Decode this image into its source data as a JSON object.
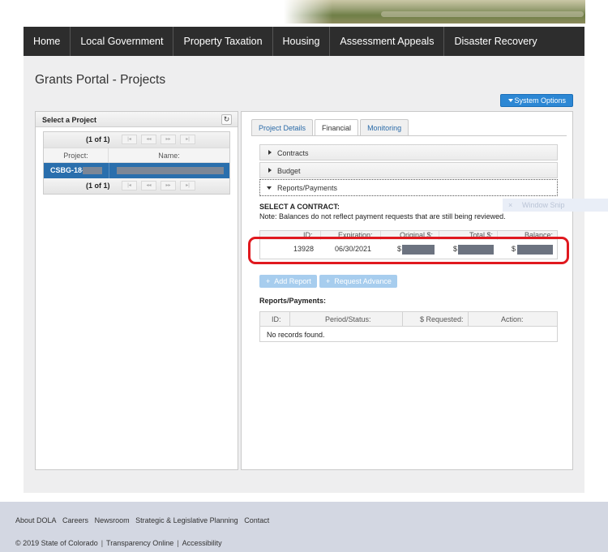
{
  "nav": {
    "items": [
      "Home",
      "Local Government",
      "Property Taxation",
      "Housing",
      "Assessment Appeals",
      "Disaster Recovery"
    ]
  },
  "page": {
    "title": "Grants Portal - Projects"
  },
  "system_options": {
    "label": "System Options"
  },
  "left_panel": {
    "title": "Select a Project",
    "pager_report": "(1 of 1)",
    "pager_buttons": [
      "|◂",
      "◂◂",
      "▸▸",
      "▸|"
    ],
    "columns": [
      "Project:",
      "Name:"
    ],
    "selected_project_prefix": "CSBG-18-"
  },
  "right_panel": {
    "tabs": [
      "Project Details",
      "Financial",
      "Monitoring"
    ],
    "active_tab": "Financial",
    "accordion": [
      "Contracts",
      "Budget",
      "Reports/Payments"
    ],
    "select_contract_label": "SELECT A CONTRACT:",
    "select_contract_note": "Note: Balances do not reflect payment requests that are still being reviewed.",
    "contract_columns": [
      "ID:",
      "Expiration:",
      "Original $:",
      "Total $:",
      "Balance:"
    ],
    "contract_row": {
      "id": "13928",
      "expiration": "06/30/2021",
      "original": "$",
      "total": "$",
      "balance": "$"
    },
    "add_report_label": "Add Report",
    "request_advance_label": "Request Advance",
    "reports_label": "Reports/Payments:",
    "reports_columns": [
      "ID:",
      "Period/Status:",
      "$ Requested:",
      "Action:"
    ],
    "reports_empty": "No records found."
  },
  "window_snip": {
    "label": "Window Snip"
  },
  "footer": {
    "links": [
      "About DOLA",
      "Careers",
      "Newsroom",
      "Strategic & Legislative Planning",
      "Contact"
    ],
    "copyright": "© 2019 State of Colorado",
    "bottom_links": [
      "Transparency Online",
      "Accessibility"
    ]
  },
  "colors": {
    "nav_bg": "#2d2d2d",
    "accent_blue": "#2c87d4",
    "selected_row": "#2a6fad",
    "highlight_red": "#e0191f"
  }
}
